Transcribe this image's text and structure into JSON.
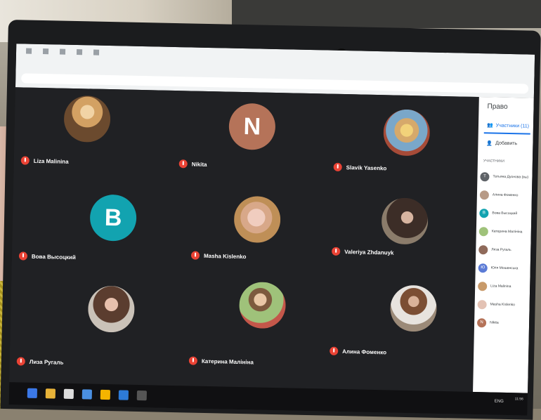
{
  "meet": {
    "tiles": [
      {
        "name": "Liza Malinina",
        "avatar_type": "photo",
        "avatar_color": "#c89a6a"
      },
      {
        "name": "Nikita",
        "avatar_type": "letter",
        "letter": "N",
        "avatar_color": "#b57359"
      },
      {
        "name": "Slavik Yasenko",
        "avatar_type": "photo",
        "avatar_color": "#7aa7c9"
      },
      {
        "name": "Вова Высоцкий",
        "avatar_type": "letter",
        "letter": "B",
        "avatar_color": "#12a3b0"
      },
      {
        "name": "Masha Kislenko",
        "avatar_type": "photo",
        "avatar_color": "#e3c2b4"
      },
      {
        "name": "Valeriya Zhdanuyk",
        "avatar_type": "photo",
        "avatar_color": "#5c4c44"
      },
      {
        "name": "Лиза Ругаль",
        "avatar_type": "photo",
        "avatar_color": "#8f6a5a"
      },
      {
        "name": "Катерина Малініна",
        "avatar_type": "photo",
        "avatar_color": "#9fc27a"
      },
      {
        "name": "Алина Фоменко",
        "avatar_type": "photo",
        "avatar_color": "#b79a86"
      }
    ]
  },
  "sidebar": {
    "title": "Право",
    "participants_tab": "Участники (11)",
    "add_label": "Добавить",
    "section_label": "УЧАСТНИКИ",
    "participants": [
      {
        "name": "Татьяна Дуонова (вы)",
        "color": "#5f6368",
        "letter": "Т"
      },
      {
        "name": "Алина Фоменко",
        "color": "#b79a86",
        "letter": ""
      },
      {
        "name": "Вова Высоцкий",
        "color": "#12a3b0",
        "letter": "B"
      },
      {
        "name": "Катерина Малініна",
        "color": "#9fc27a",
        "letter": ""
      },
      {
        "name": "Лиза Ругаль",
        "color": "#8f6a5a",
        "letter": ""
      },
      {
        "name": "Юля Мошенська",
        "color": "#5b7bd6",
        "letter": "Ю"
      },
      {
        "name": "Liza Malinina",
        "color": "#c89a6a",
        "letter": ""
      },
      {
        "name": "Masha Kislenko",
        "color": "#e3c2b4",
        "letter": ""
      },
      {
        "name": "Nikita",
        "color": "#b57359",
        "letter": "N"
      }
    ]
  },
  "taskbar": {
    "language": "ENG",
    "time": "11:56"
  }
}
